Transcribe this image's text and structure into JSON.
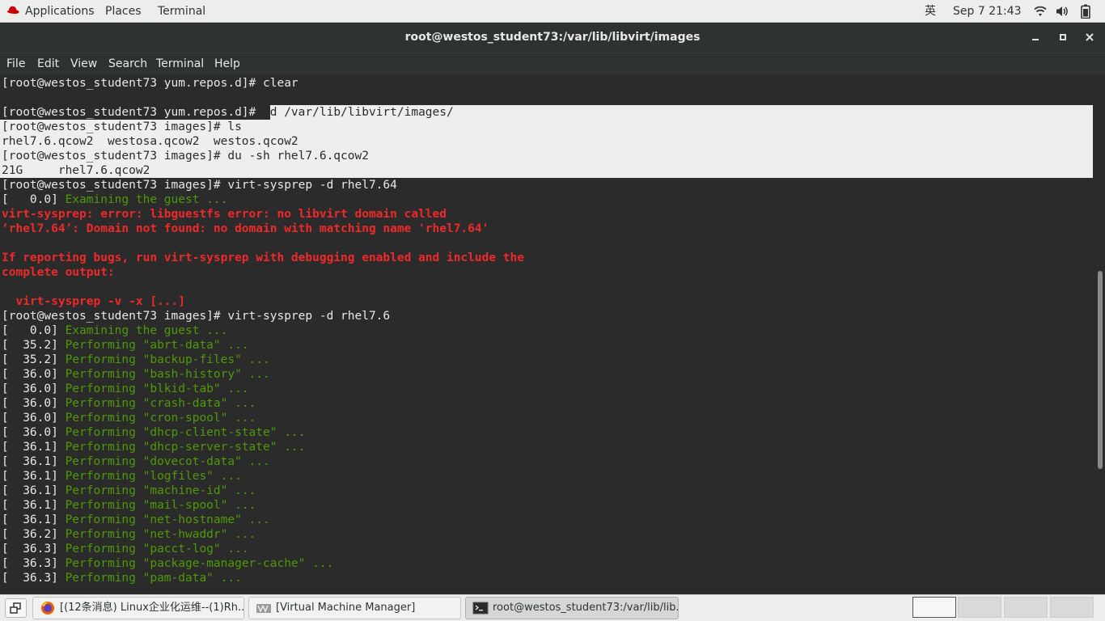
{
  "topbar": {
    "applications": "Applications",
    "places": "Places",
    "terminal": "Terminal",
    "ime": "英",
    "clock": "Sep 7  21:43"
  },
  "window": {
    "title": "root@westos_student73:/var/lib/libvirt/images"
  },
  "menubar": {
    "items": [
      "File",
      "Edit",
      "View",
      "Search",
      "Terminal",
      "Help"
    ]
  },
  "terminal": {
    "lines": [
      {
        "type": "plain",
        "text": "[root@westos_student73 yum.repos.d]# clear"
      },
      {
        "type": "plain",
        "text": ""
      },
      {
        "type": "partsel",
        "prefix": "[root@westos_student73 yum.repos.d]# ",
        "text": "cd /var/lib/libvirt/images/"
      },
      {
        "type": "sel",
        "text": "[root@westos_student73 images]# ls"
      },
      {
        "type": "sel",
        "text": "rhel7.6.qcow2  westosa.qcow2  westos.qcow2"
      },
      {
        "type": "sel",
        "text": "[root@westos_student73 images]# du -sh rhel7.6.qcow2"
      },
      {
        "type": "sel",
        "text": "21G\trhel7.6.qcow2"
      },
      {
        "type": "plain",
        "text": "[root@westos_student73 images]# virt-sysprep -d rhel7.64"
      },
      {
        "type": "status",
        "ts": "[   0.0] ",
        "text": "Examining the guest ..."
      },
      {
        "type": "red",
        "text": "virt-sysprep: error: libguestfs error: no libvirt domain called"
      },
      {
        "type": "red",
        "text": "‘rhel7.64’: Domain not found: no domain with matching name 'rhel7.64'"
      },
      {
        "type": "red",
        "text": ""
      },
      {
        "type": "red",
        "text": "If reporting bugs, run virt-sysprep with debugging enabled and include the"
      },
      {
        "type": "red",
        "text": "complete output:"
      },
      {
        "type": "red",
        "text": ""
      },
      {
        "type": "red",
        "text": "  virt-sysprep -v -x [...]"
      },
      {
        "type": "plain",
        "text": "[root@westos_student73 images]# virt-sysprep -d rhel7.6"
      },
      {
        "type": "status",
        "ts": "[   0.0] ",
        "text": "Examining the guest ..."
      },
      {
        "type": "status",
        "ts": "[  35.2] ",
        "text": "Performing \"abrt-data\" ..."
      },
      {
        "type": "status",
        "ts": "[  35.2] ",
        "text": "Performing \"backup-files\" ..."
      },
      {
        "type": "status",
        "ts": "[  36.0] ",
        "text": "Performing \"bash-history\" ..."
      },
      {
        "type": "status",
        "ts": "[  36.0] ",
        "text": "Performing \"blkid-tab\" ..."
      },
      {
        "type": "status",
        "ts": "[  36.0] ",
        "text": "Performing \"crash-data\" ..."
      },
      {
        "type": "status",
        "ts": "[  36.0] ",
        "text": "Performing \"cron-spool\" ..."
      },
      {
        "type": "status",
        "ts": "[  36.0] ",
        "text": "Performing \"dhcp-client-state\" ..."
      },
      {
        "type": "status",
        "ts": "[  36.1] ",
        "text": "Performing \"dhcp-server-state\" ..."
      },
      {
        "type": "status",
        "ts": "[  36.1] ",
        "text": "Performing \"dovecot-data\" ..."
      },
      {
        "type": "status",
        "ts": "[  36.1] ",
        "text": "Performing \"logfiles\" ..."
      },
      {
        "type": "status",
        "ts": "[  36.1] ",
        "text": "Performing \"machine-id\" ..."
      },
      {
        "type": "status",
        "ts": "[  36.1] ",
        "text": "Performing \"mail-spool\" ..."
      },
      {
        "type": "status",
        "ts": "[  36.1] ",
        "text": "Performing \"net-hostname\" ..."
      },
      {
        "type": "status",
        "ts": "[  36.2] ",
        "text": "Performing \"net-hwaddr\" ..."
      },
      {
        "type": "status",
        "ts": "[  36.3] ",
        "text": "Performing \"pacct-log\" ..."
      },
      {
        "type": "status",
        "ts": "[  36.3] ",
        "text": "Performing \"package-manager-cache\" ..."
      },
      {
        "type": "status",
        "ts": "[  36.3] ",
        "text": "Performing \"pam-data\" ..."
      }
    ]
  },
  "taskbar": {
    "tasks": [
      {
        "label": "[(12条消息) Linux企业化运维--(1)Rh...",
        "icon": "firefox-icon"
      },
      {
        "label": "[Virtual Machine Manager]",
        "icon": "virt-manager-icon"
      },
      {
        "label": "root@westos_student73:/var/lib/lib...",
        "icon": "terminal-icon"
      }
    ]
  },
  "colors": {
    "terminal_bg": "#2b2b2b",
    "prompt_fg": "#e8e8e8",
    "status_green": "#4e9a06",
    "error_red": "#ef2929",
    "selection_bg": "#eeeeec"
  }
}
